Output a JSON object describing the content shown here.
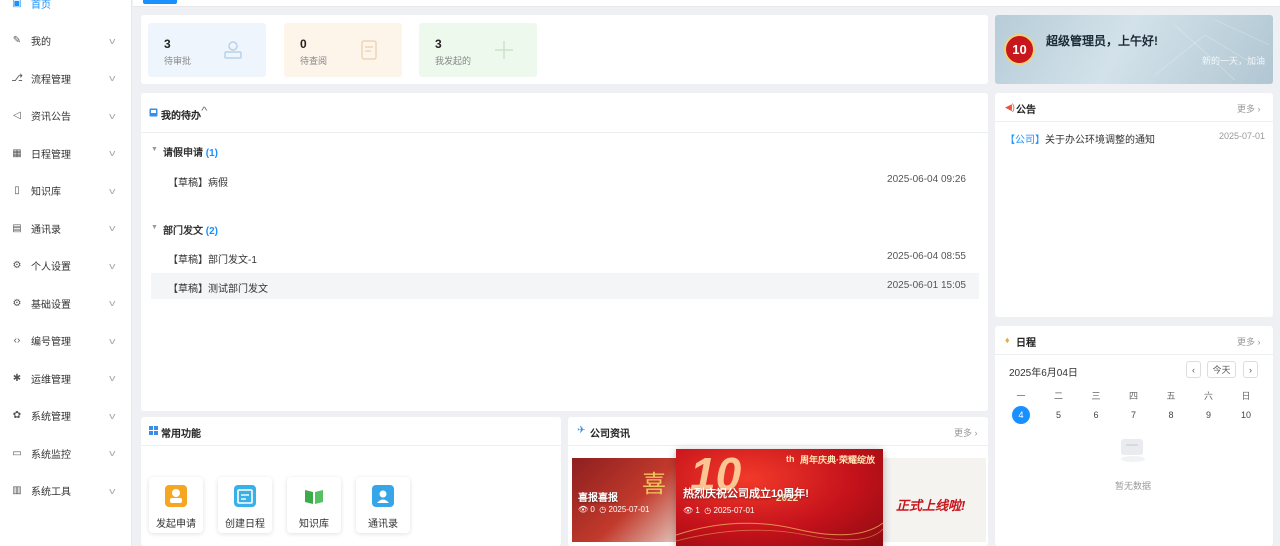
{
  "sidebar": {
    "items": [
      {
        "label": "首页",
        "icon": "dashboard-icon",
        "active": true
      },
      {
        "label": "我的",
        "icon": "edit-doc-icon"
      },
      {
        "label": "流程管理",
        "icon": "flow-icon"
      },
      {
        "label": "资讯公告",
        "icon": "speaker-icon"
      },
      {
        "label": "日程管理",
        "icon": "calendar-icon"
      },
      {
        "label": "知识库",
        "icon": "book-icon"
      },
      {
        "label": "通讯录",
        "icon": "contacts-icon"
      },
      {
        "label": "个人设置",
        "icon": "gear-icon"
      },
      {
        "label": "基础设置",
        "icon": "gear-icon"
      },
      {
        "label": "编号管理",
        "icon": "code-icon"
      },
      {
        "label": "运维管理",
        "icon": "bug-icon"
      },
      {
        "label": "系统管理",
        "icon": "cog-icon"
      },
      {
        "label": "系统监控",
        "icon": "monitor-icon"
      },
      {
        "label": "系统工具",
        "icon": "toolbox-icon"
      }
    ]
  },
  "stats": [
    {
      "count": "3",
      "label": "待审批",
      "color": "#eef5fd"
    },
    {
      "count": "0",
      "label": "待查阅",
      "color": "#fdf4ea"
    },
    {
      "count": "3",
      "label": "我发起的",
      "color": "#eef9ee"
    }
  ],
  "greeting": {
    "text": "超级管理员，上午好!",
    "sub": "新的一天，加油",
    "badge": "10"
  },
  "todo": {
    "title": "我的待办",
    "groups": [
      {
        "name": "请假申请",
        "count": "(1)",
        "items": [
          {
            "title": "【草稿】病假",
            "date": "2025-06-04 09:26"
          }
        ]
      },
      {
        "name": "部门发文",
        "count": "(2)",
        "items": [
          {
            "title": "【草稿】部门发文-1",
            "date": "2025-06-04 08:55"
          },
          {
            "title": "【草稿】测试部门发文",
            "date": "2025-06-01 15:05"
          }
        ]
      }
    ]
  },
  "notice": {
    "title": "公告",
    "more": "更多",
    "items": [
      {
        "tag": "【公司】",
        "text": "关于办公环境调整的通知",
        "date": "2025-07-01"
      }
    ]
  },
  "schedule": {
    "title": "日程",
    "more": "更多",
    "month": "2025年6月04日",
    "today_btn": "今天",
    "weekdays": [
      "一",
      "二",
      "三",
      "四",
      "五",
      "六",
      "日"
    ],
    "days": [
      "4",
      "5",
      "6",
      "7",
      "8",
      "9",
      "10"
    ],
    "today": "4",
    "empty": "暂无数据"
  },
  "quick": {
    "title": "常用功能",
    "items": [
      {
        "label": "发起申请",
        "color": "#f5a623"
      },
      {
        "label": "创建日程",
        "color": "#3ab0e8"
      },
      {
        "label": "知识库",
        "color": "#3daa4a"
      },
      {
        "label": "通讯录",
        "color": "#36a6e8"
      }
    ]
  },
  "news": {
    "title": "公司资讯",
    "more": "更多",
    "items": [
      {
        "title": "喜报喜报",
        "views": "0",
        "date": "2025-07-01"
      },
      {
        "title": "热烈庆祝公司成立10周年!",
        "views": "1",
        "date": "2025-07-01",
        "banner": "周年庆典·荣耀绽放",
        "year": "2022",
        "big": "10",
        "th": "th"
      },
      {
        "title": "正式上线啦!"
      }
    ]
  },
  "colors": {
    "accent": "#1890ff"
  }
}
